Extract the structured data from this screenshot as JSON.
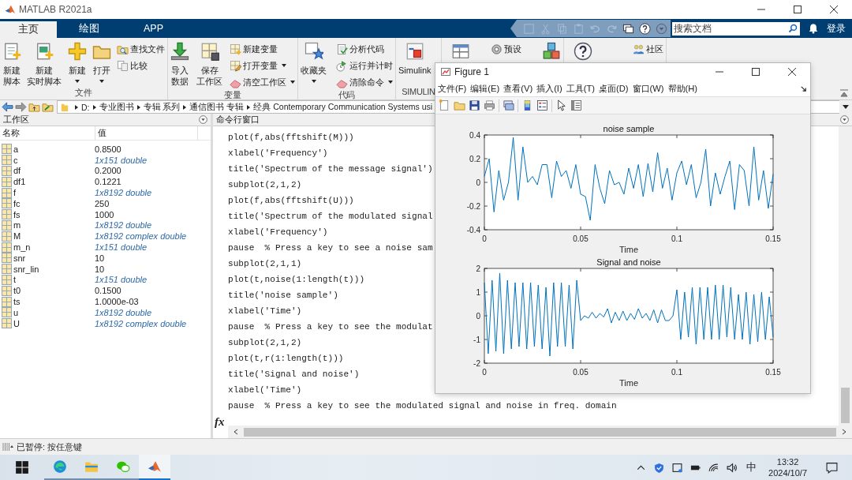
{
  "window": {
    "title": "MATLAB R2021a"
  },
  "tabs": [
    {
      "label": "主页",
      "selected": true
    },
    {
      "label": "绘图",
      "selected": false
    },
    {
      "label": "APP",
      "selected": false
    }
  ],
  "search": {
    "placeholder": "搜索文档"
  },
  "sign_in": "登录",
  "toolstrip": [
    {
      "label": "文件",
      "groups": [
        {
          "kind": "large",
          "lines": [
            "新建",
            "脚本"
          ],
          "dropdown": false
        },
        {
          "kind": "large",
          "lines": [
            "新建",
            "实时脚本"
          ],
          "dropdown": false
        },
        {
          "kind": "large",
          "lines": [
            "新建"
          ],
          "dropdown": true
        },
        {
          "kind": "large",
          "lines": [
            "打开"
          ],
          "dropdown": true
        },
        {
          "kind": "column",
          "items": [
            {
              "label": "查找文件",
              "dropdown": false
            },
            {
              "label": "比较",
              "dropdown": false
            }
          ]
        }
      ]
    },
    {
      "label": "变量",
      "groups": [
        {
          "kind": "large",
          "lines": [
            "导入",
            "数据"
          ],
          "dropdown": false
        },
        {
          "kind": "large",
          "lines": [
            "保存",
            "工作区"
          ],
          "dropdown": false
        },
        {
          "kind": "column",
          "items": [
            {
              "label": "新建变量",
              "dropdown": false
            },
            {
              "label": "打开变量",
              "dropdown": true
            },
            {
              "label": "清空工作区",
              "dropdown": true
            }
          ]
        }
      ]
    },
    {
      "label": "代码",
      "groups": [
        {
          "kind": "large",
          "lines": [
            "收藏夹"
          ],
          "dropdown": true
        },
        {
          "kind": "column",
          "items": [
            {
              "label": "分析代码",
              "dropdown": false
            },
            {
              "label": "运行并计时",
              "dropdown": false
            },
            {
              "label": "清除命令",
              "dropdown": true
            }
          ]
        }
      ]
    },
    {
      "label": "SIMULIN",
      "groups": [
        {
          "kind": "large",
          "lines": [
            "Simulink"
          ],
          "dropdown": false
        }
      ]
    },
    {
      "groups": [
        {
          "kind": "large",
          "dropdown": false
        },
        {
          "kind": "column",
          "items": [
            {
              "label": "预设",
              "dropdown": false
            }
          ]
        },
        {
          "kind": "large",
          "dropdown": false
        }
      ]
    },
    {
      "groups": [
        {
          "kind": "large",
          "dropdown": false
        },
        {
          "kind": "column",
          "items": [
            {
              "label": "社区",
              "dropdown": false
            }
          ]
        }
      ]
    }
  ],
  "address_bar": {
    "segments": [
      "D:",
      "专业图书",
      "专辑 系列",
      "通信图书  专辑",
      "经典 Contemporary Communication Systems usi"
    ]
  },
  "workspace": {
    "title": "工作区",
    "columns": [
      "名称",
      "值"
    ],
    "rows": [
      {
        "name": "a",
        "value": "0.8500",
        "kind": "scalar"
      },
      {
        "name": "c",
        "value": "1x151 double",
        "kind": "array"
      },
      {
        "name": "df",
        "value": "0.2000",
        "kind": "scalar"
      },
      {
        "name": "df1",
        "value": "0.1221",
        "kind": "scalar"
      },
      {
        "name": "f",
        "value": "1x8192 double",
        "kind": "array"
      },
      {
        "name": "fc",
        "value": "250",
        "kind": "scalar"
      },
      {
        "name": "fs",
        "value": "1000",
        "kind": "scalar"
      },
      {
        "name": "m",
        "value": "1x8192 double",
        "kind": "array"
      },
      {
        "name": "M",
        "value": "1x8192 complex double",
        "kind": "array"
      },
      {
        "name": "m_n",
        "value": "1x151 double",
        "kind": "array"
      },
      {
        "name": "snr",
        "value": "10",
        "kind": "scalar"
      },
      {
        "name": "snr_lin",
        "value": "10",
        "kind": "scalar"
      },
      {
        "name": "t",
        "value": "1x151 double",
        "kind": "array"
      },
      {
        "name": "t0",
        "value": "0.1500",
        "kind": "scalar"
      },
      {
        "name": "ts",
        "value": "1.0000e-03",
        "kind": "scalar"
      },
      {
        "name": "u",
        "value": "1x8192 double",
        "kind": "array"
      },
      {
        "name": "U",
        "value": "1x8192 complex double",
        "kind": "array"
      }
    ]
  },
  "command_window": {
    "title": "命令行窗口",
    "prompt": "fx",
    "lines": [
      "plot(f,abs(fftshift(M)))",
      "xlabel('Frequency')",
      "title('Spectrum of the message signal')",
      "subplot(2,1,2)",
      "plot(f,abs(fftshift(U)))",
      "title('Spectrum of the modulated signal",
      "xlabel('Frequency')",
      "pause  % Press a key to see a noise sam",
      "subplot(2,1,1)",
      "plot(t,noise(1:length(t)))",
      "title('noise sample')",
      "xlabel('Time')",
      "pause  % Press a key to see the modulat",
      "subplot(2,1,2)",
      "plot(t,r(1:length(t)))",
      "title('Signal and noise')",
      "xlabel('Time')",
      "pause  % Press a key to see the modulated signal and noise in freq. domain"
    ]
  },
  "status_bar": {
    "text": "已暂停: 按任意键"
  },
  "figure": {
    "title": "Figure 1",
    "menu": [
      "文件(F)",
      "编辑(E)",
      "查看(V)",
      "插入(I)",
      "工具(T)",
      "桌面(D)",
      "窗口(W)",
      "帮助(H)"
    ],
    "charts": [
      {
        "chart_data": {
          "type": "line",
          "title": "noise sample",
          "xlabel": "Time",
          "xlim": [
            0,
            0.15
          ],
          "ylim": [
            -0.4,
            0.4
          ],
          "xticks": [
            0,
            0.05,
            0.1,
            0.15
          ],
          "yticks": [
            -0.4,
            -0.2,
            0,
            0.2,
            0.4
          ],
          "x": [
            0,
            0.0025,
            0.005,
            0.0075,
            0.01,
            0.0125,
            0.015,
            0.0175,
            0.02,
            0.0225,
            0.025,
            0.0275,
            0.03,
            0.0325,
            0.035,
            0.0375,
            0.04,
            0.0425,
            0.045,
            0.0475,
            0.05,
            0.0525,
            0.055,
            0.0575,
            0.06,
            0.0625,
            0.065,
            0.0675,
            0.07,
            0.0725,
            0.075,
            0.0775,
            0.08,
            0.0825,
            0.085,
            0.0875,
            0.09,
            0.0925,
            0.095,
            0.0975,
            0.1,
            0.1025,
            0.105,
            0.1075,
            0.11,
            0.1125,
            0.115,
            0.1175,
            0.12,
            0.1225,
            0.125,
            0.1275,
            0.13,
            0.1325,
            0.135,
            0.1375,
            0.14,
            0.1425,
            0.145,
            0.1475,
            0.15
          ],
          "series": [
            {
              "color": "#0072bd",
              "values": [
                0.05,
                0.2,
                -0.25,
                0.1,
                -0.15,
                0.0,
                0.38,
                -0.15,
                0.3,
                0.0,
                0.05,
                -0.02,
                0.15,
                0.15,
                -0.13,
                0.18,
                0.05,
                0.1,
                -0.05,
                0.15,
                -0.1,
                -0.12,
                -0.32,
                0.15,
                -0.05,
                -0.18,
                0.1,
                -0.02,
                0.0,
                -0.1,
                0.12,
                -0.05,
                0.15,
                -0.12,
                0.16,
                -0.08,
                0.25,
                -0.05,
                0.12,
                -0.15,
                0.08,
                0.18,
                -0.02,
                0.15,
                -0.13,
                0.0,
                0.28,
                -0.2,
                0.08,
                -0.1,
                0.05,
                0.18,
                -0.23,
                0.15,
                0.1,
                -0.2,
                0.3,
                -0.15,
                0.1,
                -0.22,
                0.07
              ]
            }
          ]
        }
      },
      {
        "chart_data": {
          "type": "line",
          "title": "Signal and noise",
          "xlabel": "Time",
          "xlim": [
            0,
            0.15
          ],
          "ylim": [
            -2,
            2
          ],
          "xticks": [
            0,
            0.05,
            0.1,
            0.15
          ],
          "yticks": [
            -2,
            -1,
            0,
            1,
            2
          ],
          "x": [
            0,
            0.002,
            0.004,
            0.006,
            0.008,
            0.01,
            0.012,
            0.014,
            0.016,
            0.018,
            0.02,
            0.022,
            0.024,
            0.026,
            0.028,
            0.03,
            0.032,
            0.034,
            0.036,
            0.038,
            0.04,
            0.042,
            0.044,
            0.046,
            0.048,
            0.05,
            0.052,
            0.054,
            0.056,
            0.058,
            0.06,
            0.062,
            0.064,
            0.066,
            0.068,
            0.07,
            0.072,
            0.074,
            0.076,
            0.078,
            0.08,
            0.082,
            0.084,
            0.086,
            0.088,
            0.09,
            0.092,
            0.094,
            0.096,
            0.098,
            0.1,
            0.102,
            0.104,
            0.106,
            0.108,
            0.11,
            0.112,
            0.114,
            0.116,
            0.118,
            0.12,
            0.122,
            0.124,
            0.126,
            0.128,
            0.13,
            0.132,
            0.134,
            0.136,
            0.138,
            0.14,
            0.142,
            0.144,
            0.146,
            0.148,
            0.15
          ],
          "series": [
            {
              "color": "#0072bd",
              "values": [
                1.4,
                -1.6,
                1.5,
                -1.5,
                1.8,
                -1.6,
                1.5,
                -1.4,
                1.4,
                -1.3,
                1.4,
                -1.4,
                1.4,
                -1.3,
                1.3,
                -1.4,
                1.2,
                -1.7,
                1.4,
                -1.3,
                1.4,
                -1.3,
                1.3,
                -1.4,
                1.5,
                -0.2,
                0.0,
                -0.1,
                0.15,
                -0.1,
                0.1,
                -0.05,
                0.3,
                -0.3,
                0.15,
                -0.2,
                0.2,
                -0.2,
                0.1,
                -0.15,
                0.3,
                -0.1,
                0.1,
                -0.2,
                0.25,
                -0.3,
                0.25,
                -0.2,
                -0.2,
                0.0,
                1.1,
                -1.0,
                1.0,
                -0.9,
                1.2,
                -1.2,
                1.2,
                -1.0,
                1.2,
                -1.0,
                1.3,
                -1.0,
                1.3,
                -0.9,
                1.2,
                -1.0,
                0.9,
                -1.0,
                1.0,
                -1.2,
                0.9,
                -1.1,
                1.0,
                -1.0,
                0.8,
                -0.9
              ]
            }
          ]
        }
      }
    ]
  },
  "taskbar": {
    "input_method": "中",
    "time": "13:32",
    "date": "2024/10/7"
  }
}
